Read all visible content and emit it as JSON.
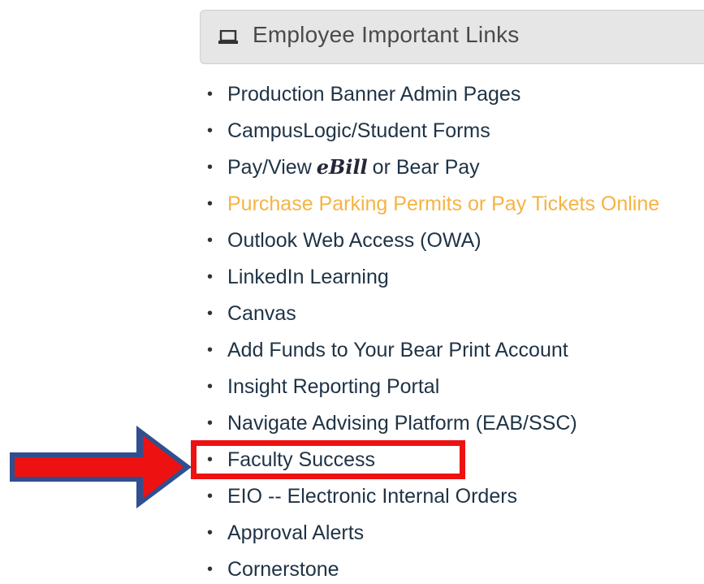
{
  "panel": {
    "icon": "laptop-icon",
    "title": "Employee Important Links"
  },
  "links": [
    {
      "label": "Production Banner Admin Pages"
    },
    {
      "label": "CampusLogic/Student Forms"
    },
    {
      "label_before": "Pay/View",
      "logo_text": "eBill",
      "label_after": "or Bear Pay"
    },
    {
      "label": "Purchase Parking Permits or Pay Tickets Online",
      "color": "#f5b342"
    },
    {
      "label": "Outlook Web Access (OWA)"
    },
    {
      "label": "LinkedIn Learning"
    },
    {
      "label": "Canvas"
    },
    {
      "label": "Add Funds to Your Bear Print Account"
    },
    {
      "label": "Insight Reporting Portal"
    },
    {
      "label": "Navigate Advising Platform (EAB/SSC)"
    },
    {
      "label": "Faculty Success",
      "highlighted": true
    },
    {
      "label": "EIO -- Electronic Internal Orders"
    },
    {
      "label": "Approval Alerts"
    },
    {
      "label": "Cornerstone"
    }
  ],
  "annotation": {
    "arrow_icon": "arrow-right-icon",
    "arrow_fill": "#ee1111",
    "arrow_outline": "#2f4f8f",
    "box_color": "#ee1111"
  },
  "colors": {
    "link_text": "#1f3345",
    "link_orange": "#f5b342",
    "heading_bg": "#e6e6e6",
    "heading_text": "#4a4a4a"
  }
}
